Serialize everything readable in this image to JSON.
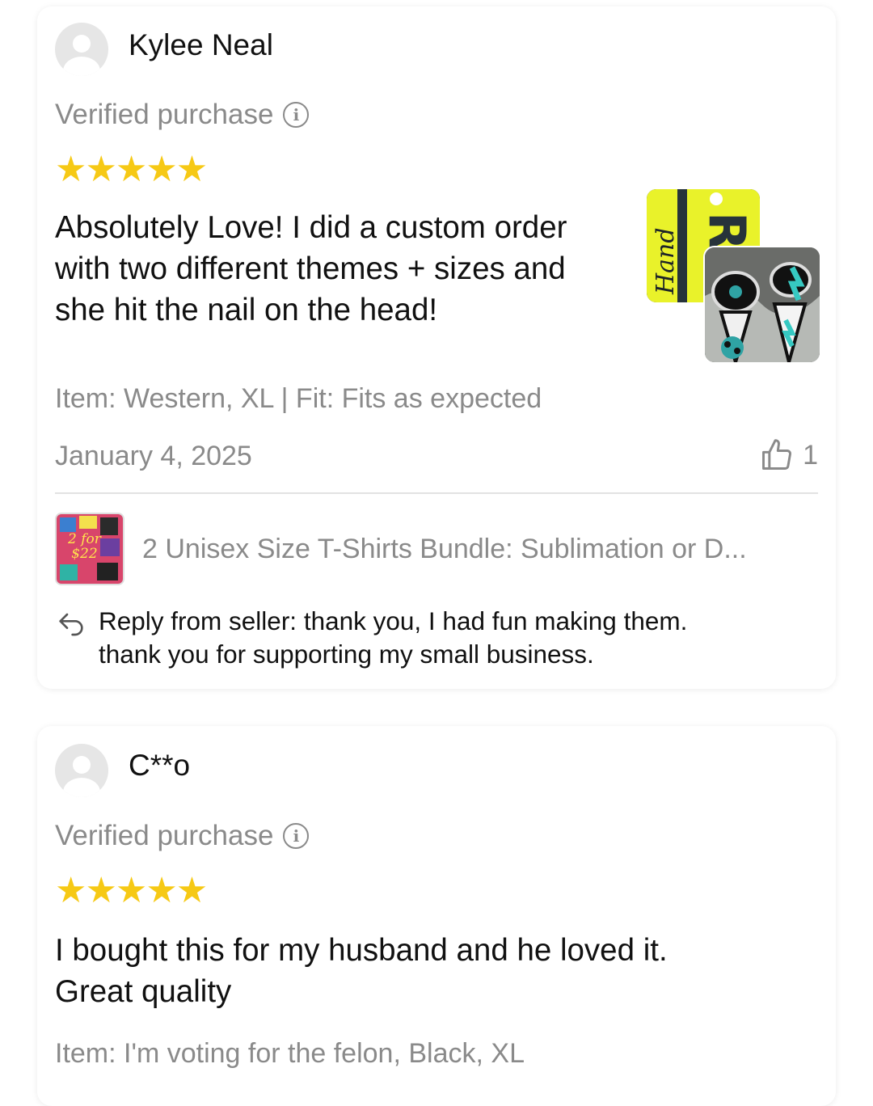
{
  "reviews": [
    {
      "reviewer": "Kylee Neal",
      "verified_label": "Verified purchase",
      "rating": 5,
      "stars": "★★★★★",
      "text_lines": [
        "Absolutely Love! I did a custom order",
        "with two different themes + sizes and",
        "she hit the nail on the head!"
      ],
      "item_info": "Item: Western, XL | Fit: Fits as expected",
      "date": "January 4, 2025",
      "likes": "1",
      "product_title": "2 Unisex Size T-Shirts Bundle: Sublimation or D...",
      "product_thumb_text": [
        "2 for",
        "$22"
      ],
      "photo_text": "RO",
      "photo_script": "Hand",
      "reply_lines": [
        "Reply from seller: thank you,  I had fun making them.",
        "thank you for supporting my small business."
      ]
    },
    {
      "reviewer": "C**o",
      "verified_label": "Verified purchase",
      "rating": 5,
      "stars": "★★★★★",
      "text_lines": [
        "I bought this for my husband and he loved it.",
        "Great quality"
      ],
      "item_info": "Item: I'm voting for the felon, Black, XL"
    }
  ],
  "colors": {
    "star": "#f6c915",
    "muted_text": "#8a8a8a",
    "divider": "#e2e2e2"
  },
  "icons": {
    "info": "info-icon",
    "like": "thumbs-up-icon",
    "reply": "reply-arrow-icon",
    "avatar": "default-avatar-icon"
  }
}
